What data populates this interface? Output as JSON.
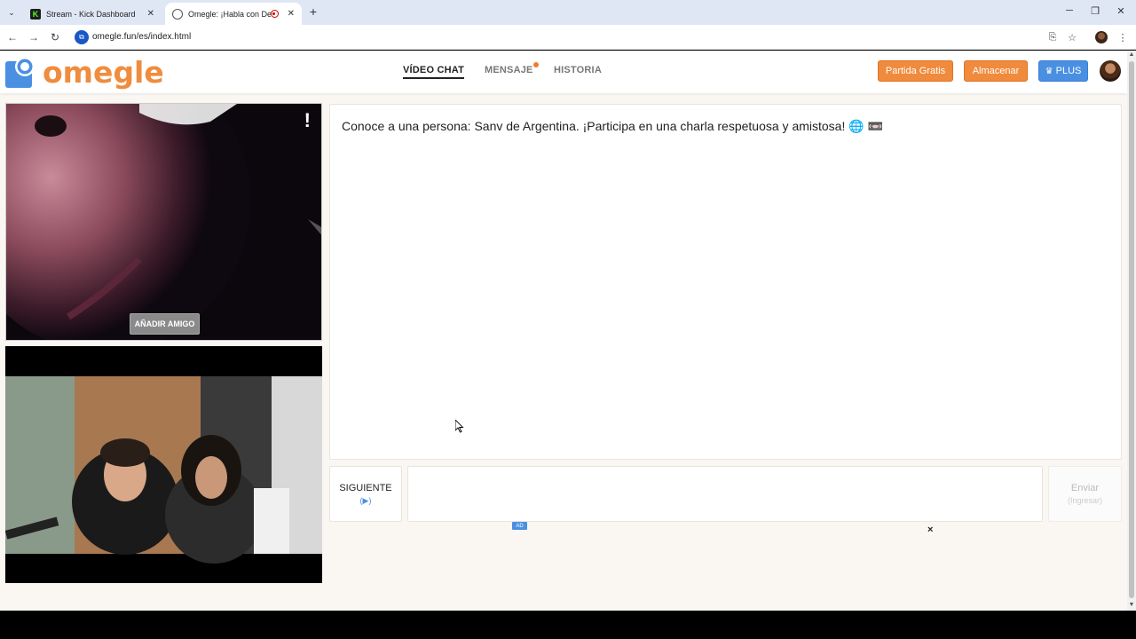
{
  "browser": {
    "tabs": [
      {
        "title": "Stream - Kick Dashboard",
        "favicon": "kick-icon",
        "active": false
      },
      {
        "title": "Omegle: ¡Habla con Descon",
        "favicon": "globe-icon",
        "active": true
      }
    ],
    "url": "omegle.fun/es/index.html",
    "new_tab_glyph": "+",
    "close_glyph": "✕",
    "kick_letter": "K"
  },
  "header": {
    "logo_text": "omegle",
    "nav": [
      {
        "label": "VÍDEO CHAT",
        "active": true
      },
      {
        "label": "MENSAJE",
        "active": false,
        "notification_dot": true
      },
      {
        "label": "HISTORIA",
        "active": false
      }
    ],
    "buttons": {
      "free_match": "Partida Gratis",
      "store": "Almacenar",
      "plus": "PLUS"
    },
    "colors": {
      "orange": "#f08a3c",
      "blue": "#4a90e2",
      "logo": "#f08c3e"
    }
  },
  "video": {
    "report_glyph": "!",
    "add_friend": "AÑADIR AMIGO"
  },
  "chat": {
    "message": "Conoce a una persona: Sanv de Argentina. ¡Participa en una charla respetuosa y amistosa! 🌐 📼",
    "next": {
      "label": "SIGUIENTE",
      "sub": "(▶)"
    },
    "input_placeholder": "",
    "send": {
      "label": "Enviar",
      "sub": "(Ingresar)"
    },
    "ad_badge": "AD",
    "ad_close": "×"
  }
}
